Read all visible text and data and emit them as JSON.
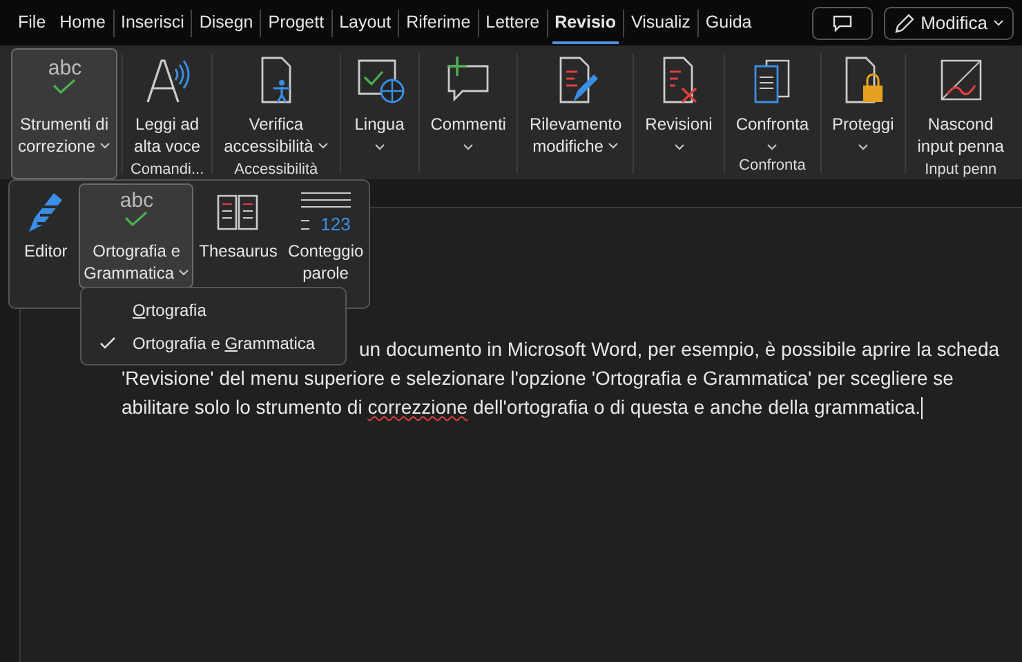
{
  "tabs": [
    {
      "label": "File",
      "selected": false
    },
    {
      "label": "Home",
      "selected": false
    },
    {
      "label": "Inserisci",
      "selected": false
    },
    {
      "label": "Disegn",
      "selected": false
    },
    {
      "label": "Progett",
      "selected": false
    },
    {
      "label": "Layout",
      "selected": false
    },
    {
      "label": "Riferime",
      "selected": false
    },
    {
      "label": "Lettere",
      "selected": false
    },
    {
      "label": "Revisio",
      "selected": true
    },
    {
      "label": "Visualiz",
      "selected": false
    },
    {
      "label": "Guida",
      "selected": false
    }
  ],
  "edit_button": {
    "label": "Modifica"
  },
  "ribbon": {
    "groups": [
      {
        "buttons": [
          {
            "kind": "abc",
            "lines": [
              "Strumenti di",
              "correzione"
            ],
            "dropdown": true,
            "selected": true
          }
        ]
      },
      {
        "label": "Comandi...",
        "buttons": [
          {
            "kind": "speak",
            "lines": [
              "Leggi ad",
              "alta voce"
            ],
            "dropdown": false,
            "selected": false
          }
        ]
      },
      {
        "label": "Accessibilità",
        "buttons": [
          {
            "kind": "access",
            "lines": [
              "Verifica",
              "accessibilità"
            ],
            "dropdown": true,
            "selected": false
          }
        ]
      },
      {
        "buttons": [
          {
            "kind": "language",
            "lines": [
              "Lingua"
            ],
            "dropdown": true,
            "selected": false
          }
        ]
      },
      {
        "buttons": [
          {
            "kind": "comment",
            "lines": [
              "Commenti"
            ],
            "dropdown": true,
            "selected": false
          }
        ]
      },
      {
        "buttons": [
          {
            "kind": "track",
            "lines": [
              "Rilevamento",
              "modifiche"
            ],
            "dropdown": true,
            "selected": false
          }
        ]
      },
      {
        "buttons": [
          {
            "kind": "reject",
            "lines": [
              "Revisioni"
            ],
            "dropdown": true,
            "selected": false
          }
        ]
      },
      {
        "label": "Confronta",
        "buttons": [
          {
            "kind": "compare",
            "lines": [
              "Confronta"
            ],
            "dropdown": true,
            "selected": false
          }
        ]
      },
      {
        "buttons": [
          {
            "kind": "protect",
            "lines": [
              "Proteggi"
            ],
            "dropdown": true,
            "selected": false
          }
        ]
      },
      {
        "label": "Input penn",
        "buttons": [
          {
            "kind": "ink",
            "lines": [
              "Nascond",
              "input penna"
            ],
            "dropdown": false,
            "selected": false
          }
        ]
      }
    ]
  },
  "flyout": {
    "buttons": [
      {
        "kind": "editor",
        "lines": [
          "Editor"
        ],
        "dropdown": false,
        "selected": false
      },
      {
        "kind": "abc",
        "lines": [
          "Ortografia e",
          "Grammatica"
        ],
        "dropdown": true,
        "selected": true
      },
      {
        "kind": "book",
        "lines": [
          "Thesaurus"
        ],
        "dropdown": false,
        "selected": false
      },
      {
        "kind": "count",
        "icon_text": "123",
        "lines": [
          "Conteggio",
          "parole"
        ],
        "dropdown": false,
        "selected": false
      }
    ]
  },
  "menu": {
    "items": [
      {
        "key": "O",
        "post": "rtografia",
        "checked": false
      },
      {
        "pre": "Ortografia e ",
        "key": "G",
        "post": "rammatica",
        "checked": true
      }
    ]
  },
  "document": {
    "lines": [
      {
        "text": "un documento in Microsoft Word, per esempio, è possibile aprire la scheda"
      },
      {
        "text": "'Revisione' del menu superiore e selezionare l'opzione 'Ortografia e Grammatica' per scegliere se"
      },
      {
        "text": "abilitare solo lo strumento di ",
        "misspelled": "correzzione",
        "after": " dell'ortografia o di questa e anche della grammatica."
      }
    ]
  }
}
